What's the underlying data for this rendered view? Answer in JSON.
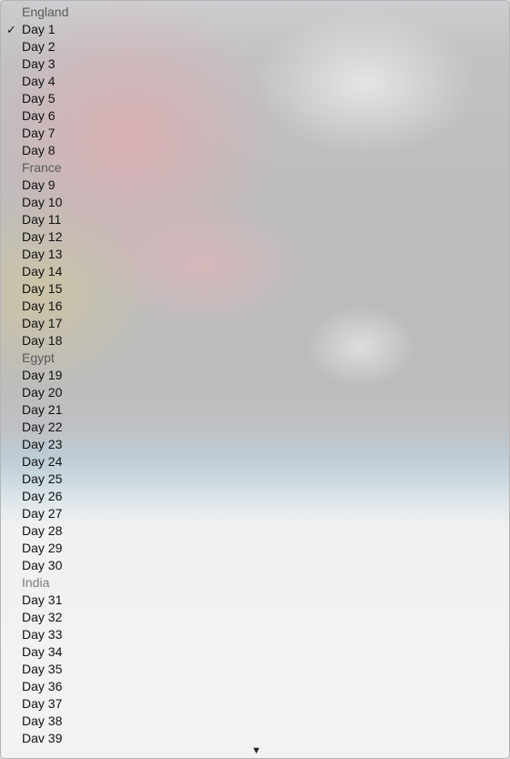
{
  "menu": {
    "selected_mark": "✓",
    "scroll_down_glyph": "▼",
    "groups": [
      {
        "title": "England",
        "items": [
          "Day 1",
          "Day 2",
          "Day 3",
          "Day 4",
          "Day 5",
          "Day 6",
          "Day 7",
          "Day 8"
        ]
      },
      {
        "title": "France",
        "items": [
          "Day 9",
          "Day 10",
          "Day 11",
          "Day 12",
          "Day 13",
          "Day 14",
          "Day 15",
          "Day 16",
          "Day 17",
          "Day 18"
        ]
      },
      {
        "title": "Egypt",
        "items": [
          "Day 19",
          "Day 20",
          "Day 21",
          "Day 22",
          "Day 23",
          "Day 24",
          "Day 25",
          "Day 26",
          "Day 27",
          "Day 28",
          "Day 29",
          "Day 30"
        ]
      },
      {
        "title": "India",
        "items": [
          "Day 31",
          "Day 32",
          "Day 33",
          "Day 34",
          "Day 35",
          "Day 36",
          "Day 37",
          "Day 38",
          "Dav 39"
        ]
      }
    ],
    "selected_item": "Day 1"
  }
}
